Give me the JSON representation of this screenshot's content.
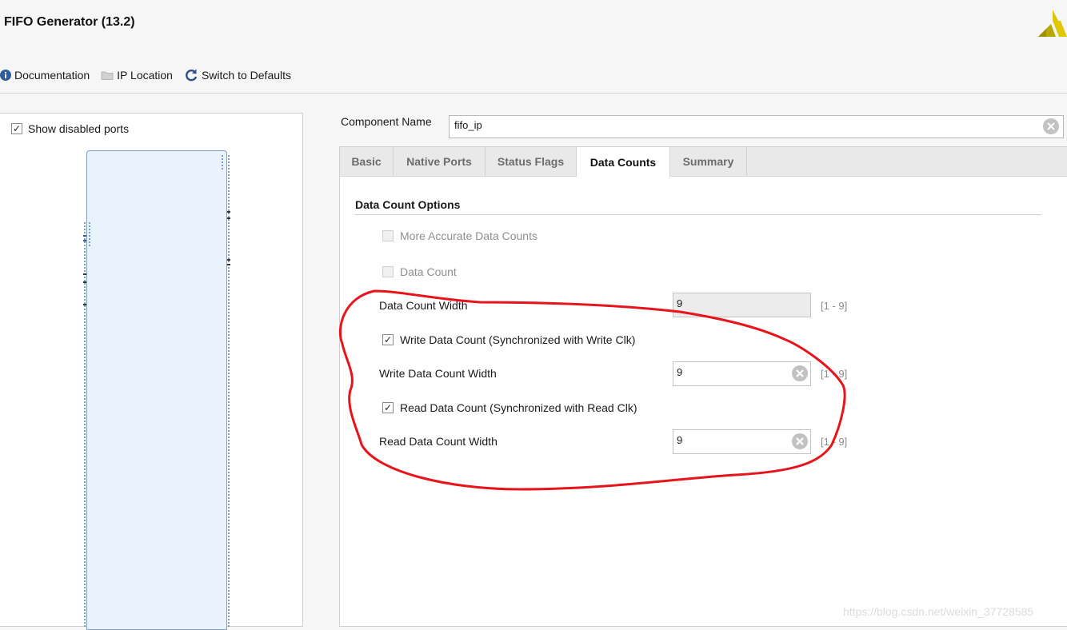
{
  "window": {
    "title": "FIFO Generator (13.2)"
  },
  "toolbar": {
    "documentation": "Documentation",
    "ip_location": "IP Location",
    "switch_defaults": "Switch to Defaults"
  },
  "left_panel": {
    "show_disabled_ports": "Show disabled ports",
    "show_disabled_checked": true
  },
  "component": {
    "label": "Component Name",
    "value": "fifo_ip"
  },
  "tabs": [
    {
      "label": "Basic",
      "active": false
    },
    {
      "label": "Native Ports",
      "active": false
    },
    {
      "label": "Status Flags",
      "active": false
    },
    {
      "label": "Data Counts",
      "active": true
    },
    {
      "label": "Summary",
      "active": false
    }
  ],
  "data_counts": {
    "section_title": "Data Count Options",
    "more_accurate": {
      "label": "More Accurate Data Counts",
      "checked": false,
      "enabled": false
    },
    "data_count": {
      "label": "Data Count",
      "checked": false,
      "enabled": false
    },
    "data_count_width": {
      "label": "Data Count Width",
      "value": "9",
      "range": "[1 - 9]"
    },
    "write_data_count": {
      "label": "Write Data Count (Synchronized with Write Clk)",
      "checked": true
    },
    "write_data_count_width": {
      "label": "Write Data Count Width",
      "value": "9",
      "range": "[1 - 9]"
    },
    "read_data_count": {
      "label": "Read Data Count (Synchronized with Read Clk)",
      "checked": true
    },
    "read_data_count_width": {
      "label": "Read Data Count Width",
      "value": "9",
      "range": "[1 - 9]"
    }
  },
  "watermark": "https://blog.csdn.net/weixin_37728585",
  "colors": {
    "annotation": "#e8141b",
    "logo": "#c6b400",
    "info": "#2f5d9e"
  }
}
